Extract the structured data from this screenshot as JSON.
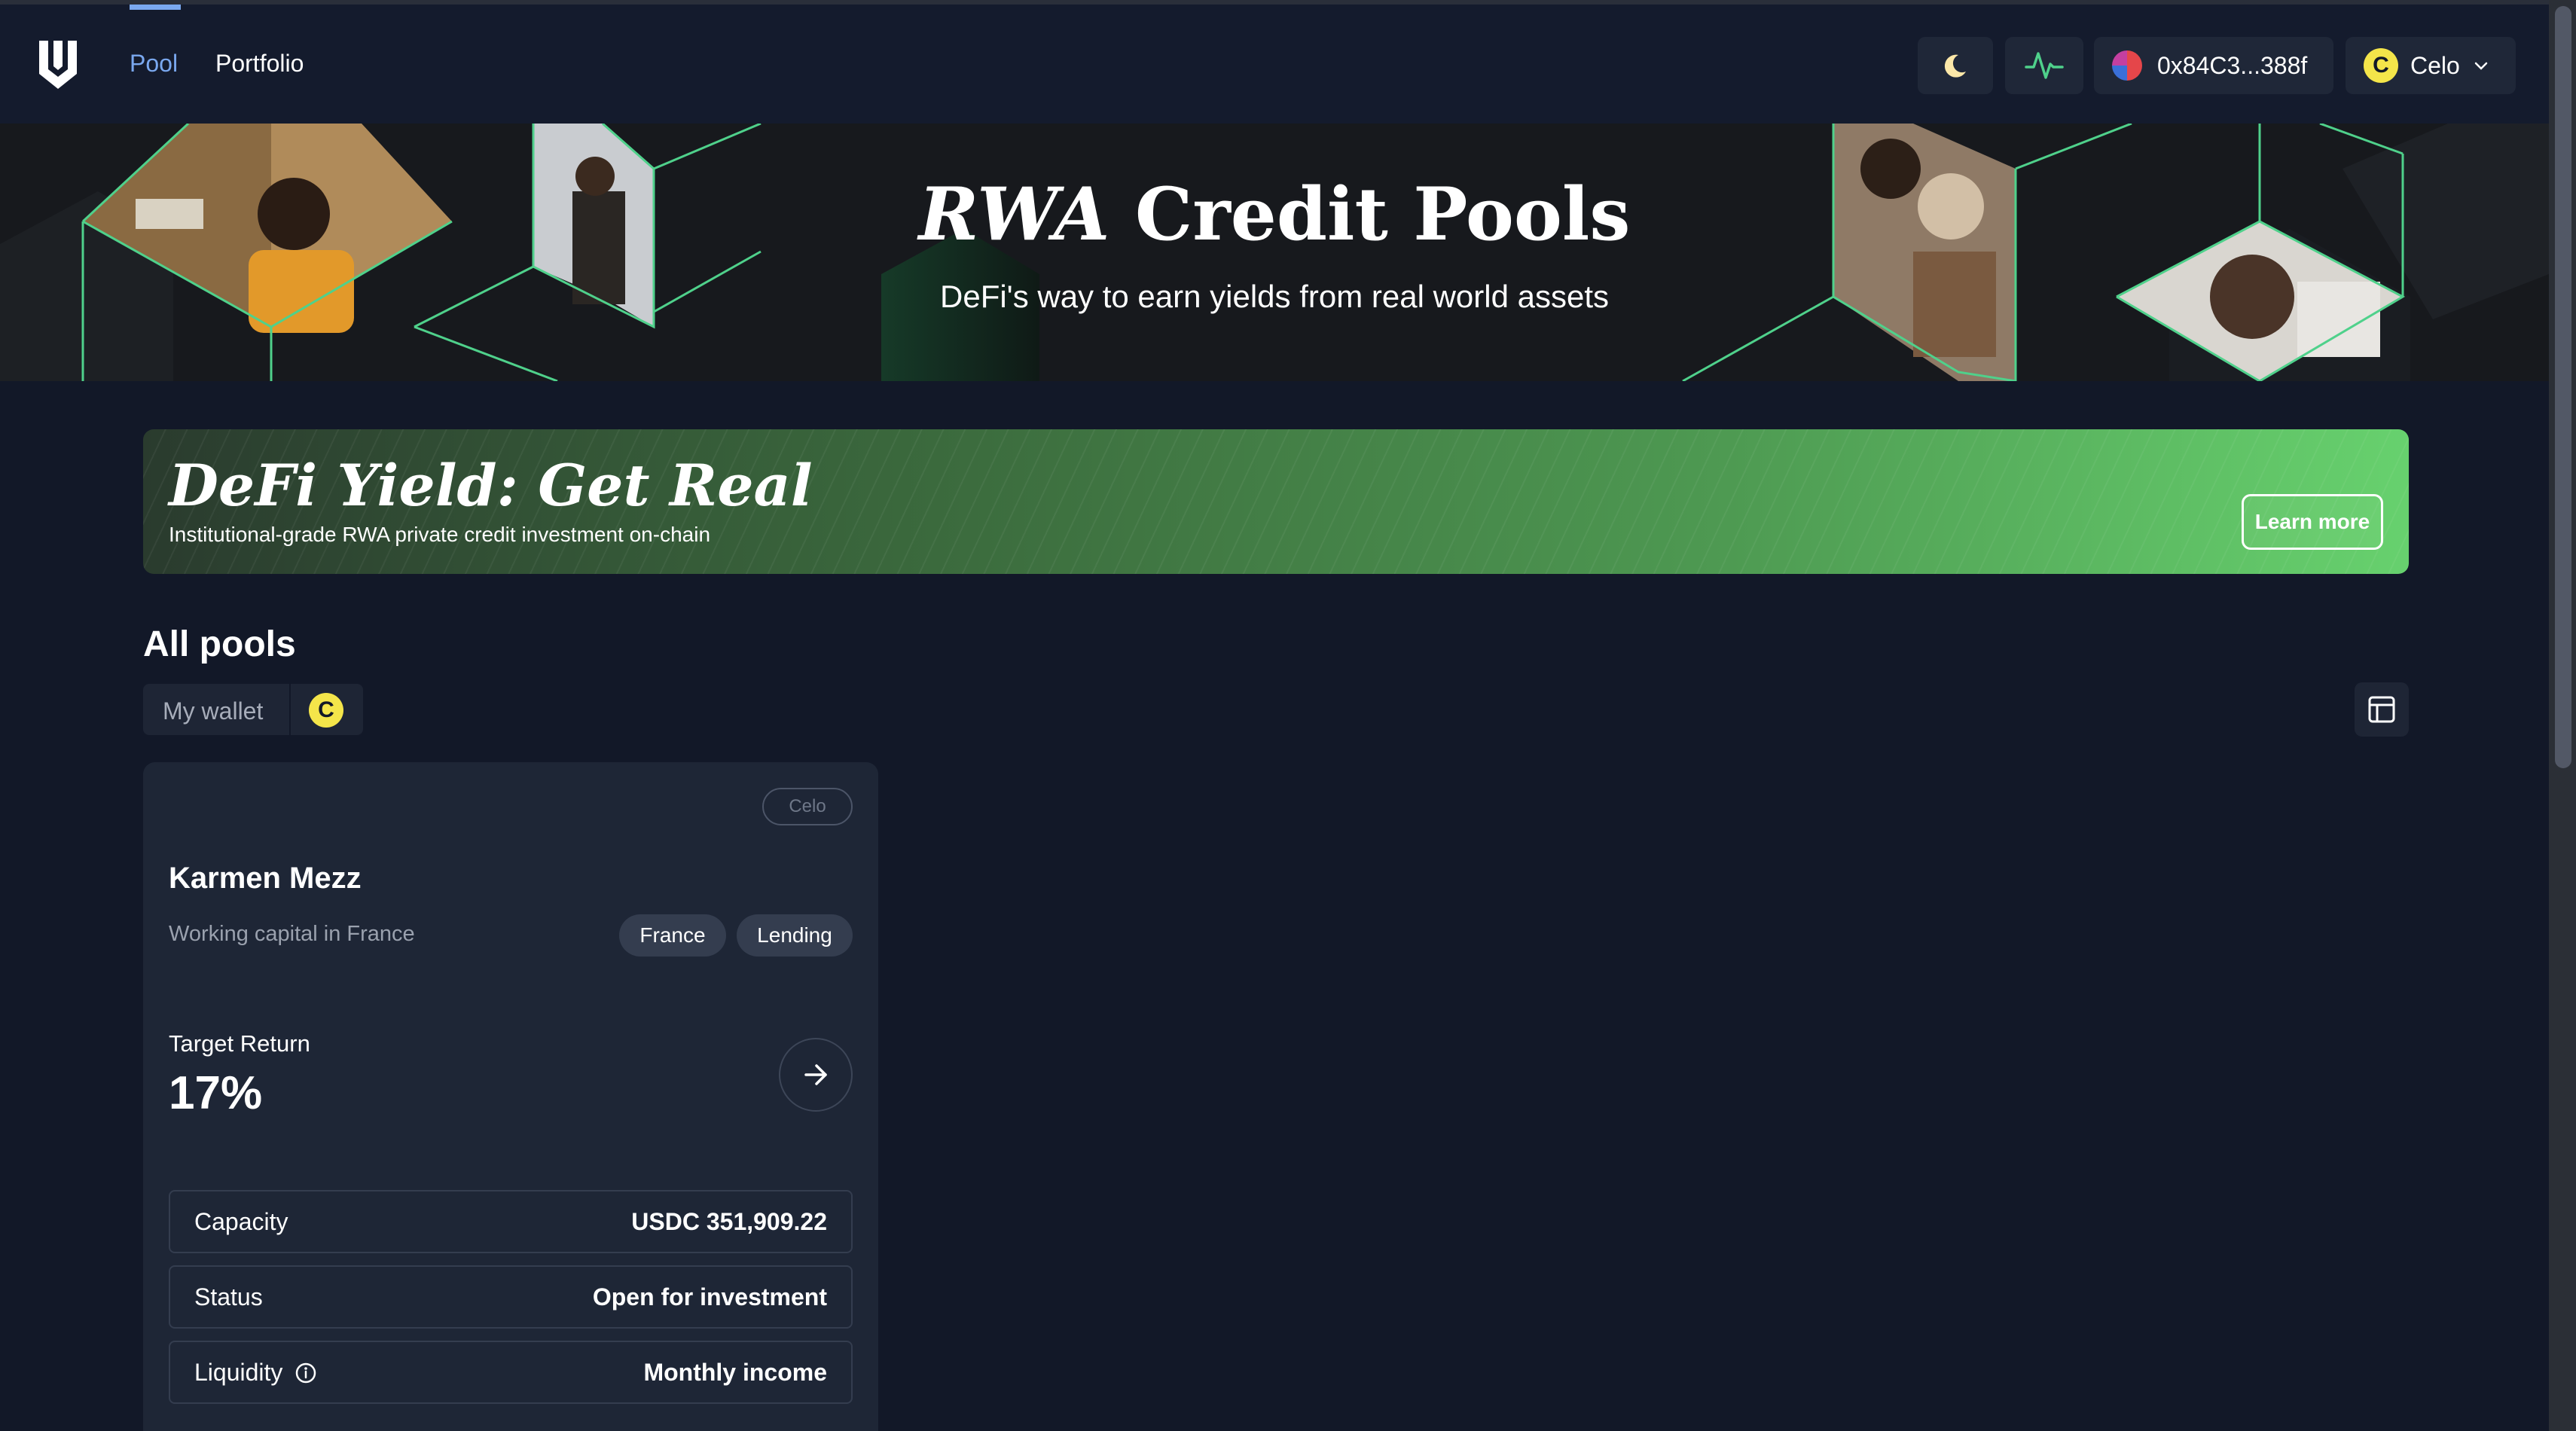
{
  "nav": {
    "pool": "Pool",
    "portfolio": "Portfolio"
  },
  "header_actions": {
    "theme_icon": "moon-icon",
    "activity_icon": "activity-icon",
    "wallet_address": "0x84C3...388f",
    "network": "Celo",
    "network_coin_letter": "C"
  },
  "hero": {
    "title_italic": "RWA",
    "title_rest": " Credit Pools",
    "subtitle": "DeFi's way to earn yields from real world assets"
  },
  "promo": {
    "title": "DeFi Yield: Get Real",
    "subtitle": "Institutional-grade RWA private credit investment on-chain",
    "button": "Learn more"
  },
  "pools": {
    "heading": "All pools",
    "filter_my_wallet": "My wallet",
    "filter_coin_letter": "C"
  },
  "pool_card": {
    "chain": "Celo",
    "name": "Karmen Mezz",
    "description": "Working capital in France",
    "tags": [
      "France",
      "Lending"
    ],
    "target_return_label": "Target Return",
    "target_return_value": "17%",
    "rows": [
      {
        "label": "Capacity",
        "value": "USDC 351,909.22"
      },
      {
        "label": "Status",
        "value": "Open for investment"
      },
      {
        "label": "Liquidity",
        "value": "Monthly income"
      }
    ]
  },
  "colors": {
    "background": "#121828",
    "header": "#141b2d",
    "accent_blue": "#7aa8ef",
    "accent_green": "#4fd18b",
    "celo_yellow": "#f4e54a",
    "card": "#1e2636"
  }
}
